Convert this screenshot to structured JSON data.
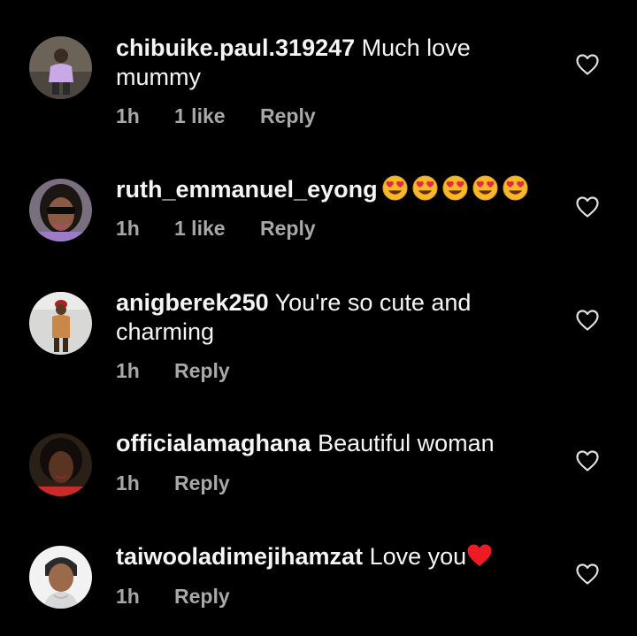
{
  "colors": {
    "background": "#000000",
    "text": "#f5f5f5",
    "meta": "#a8a8a8",
    "heart_red": "#ed1c24"
  },
  "comments": [
    {
      "username": "chibuike.paul.319247",
      "text": "Much love mummy",
      "time": "1h",
      "likes": "1 like",
      "reply": "Reply",
      "like_icon": "heart-outline-icon"
    },
    {
      "username": "ruth_emmanuel_eyong",
      "text": "",
      "emojis": [
        "heart-eyes-emoji",
        "heart-eyes-emoji",
        "heart-eyes-emoji",
        "heart-eyes-emoji",
        "heart-eyes-emoji"
      ],
      "time": "1h",
      "likes": "1 like",
      "reply": "Reply",
      "like_icon": "heart-outline-icon"
    },
    {
      "username": "anigberek250",
      "text": "You're so cute and charming",
      "time": "1h",
      "reply": "Reply",
      "like_icon": "heart-outline-icon"
    },
    {
      "username": "officialamaghana",
      "text": "Beautiful woman",
      "time": "1h",
      "reply": "Reply",
      "like_icon": "heart-outline-icon"
    },
    {
      "username": "taiwooladimejihamzat",
      "text": "Love you",
      "trailing_emoji": "red-heart-emoji",
      "time": "1h",
      "reply": "Reply",
      "like_icon": "heart-outline-icon"
    }
  ]
}
